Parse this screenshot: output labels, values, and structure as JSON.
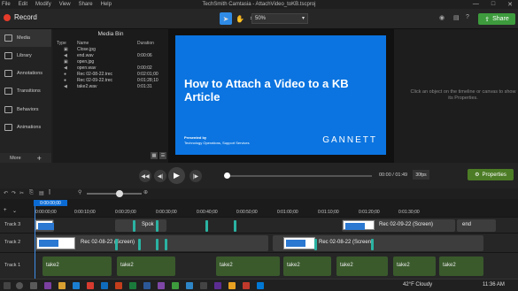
{
  "menu": [
    "File",
    "Edit",
    "Modify",
    "View",
    "Share",
    "Help"
  ],
  "window_title": "TechSmith Camtasia - AttachVideo_toKB.tscproj",
  "window_buttons": [
    "—",
    "□",
    "✕"
  ],
  "toolbar": {
    "record_label": "Record",
    "zoom_value": "50%",
    "share_label": "Share"
  },
  "nav": {
    "items": [
      {
        "label": "Media"
      },
      {
        "label": "Library"
      },
      {
        "label": "Annotations"
      },
      {
        "label": "Transitions"
      },
      {
        "label": "Behaviors"
      },
      {
        "label": "Animations"
      }
    ],
    "more_label": "More",
    "plus_label": "+"
  },
  "mediabin": {
    "title": "Media Bin",
    "headers": {
      "type": "Type",
      "name": "Name",
      "duration": "Duration"
    },
    "rows": [
      {
        "icon": "▣",
        "name": "Close.jpg",
        "duration": ""
      },
      {
        "icon": "◀",
        "name": "end.wav",
        "duration": "0:00:06"
      },
      {
        "icon": "▣",
        "name": "open.jpg",
        "duration": ""
      },
      {
        "icon": "◀",
        "name": "open.wav",
        "duration": "0:00:02"
      },
      {
        "icon": "●",
        "name": "Rec 02-08-22.trec",
        "duration": "0:02:01;00"
      },
      {
        "icon": "●",
        "name": "Rec 02-09-22.trec",
        "duration": "0:01:28;10"
      },
      {
        "icon": "◀",
        "name": "take2.wav",
        "duration": "0:01:31"
      }
    ]
  },
  "canvas": {
    "slide_title": "How to Attach a Video to a KB Article",
    "presented_by": "Presented by",
    "presenter": "Technology Operations, Support Services",
    "logo": "GANNETT"
  },
  "properties": {
    "message": "Click an object on the timeline or canvas to show its Properties."
  },
  "playback": {
    "timecode": "00:00 / 01:49",
    "fps": "30fps",
    "properties_label": "Properties"
  },
  "timeline": {
    "playhead_time": "0:00:00;00",
    "ruler_ticks": [
      "0:00:00;00",
      "0:00:10;00",
      "0:00:20;00",
      "0:00:30;00",
      "0:00:40;00",
      "0:00:50;00",
      "0:01:00;00",
      "0:01:10;00",
      "0:01:20;00",
      "0:01:30;00"
    ],
    "tracks": [
      {
        "name": "Track 3",
        "clips": [
          "Spok",
          "Rec 02-09-22 (Screen)",
          "end"
        ]
      },
      {
        "name": "Track 2",
        "clips": [
          "Rec 02-08-22 (Screen)",
          "Rec 02-08-22 (Screen)"
        ]
      },
      {
        "name": "Track 1",
        "clips": [
          "take2",
          "take2",
          "take2",
          "take2",
          "take2",
          "take2",
          "take2"
        ]
      }
    ]
  },
  "taskbar": {
    "weather": "42°F  Cloudy",
    "clock": "11:36 AM"
  },
  "colors": {
    "accent": "#0b74e0",
    "share_green": "#3d9b3d",
    "record_red": "#e43b2b",
    "clip_green": "#3a5a2c",
    "clip_screen": "#3a3a3a"
  }
}
